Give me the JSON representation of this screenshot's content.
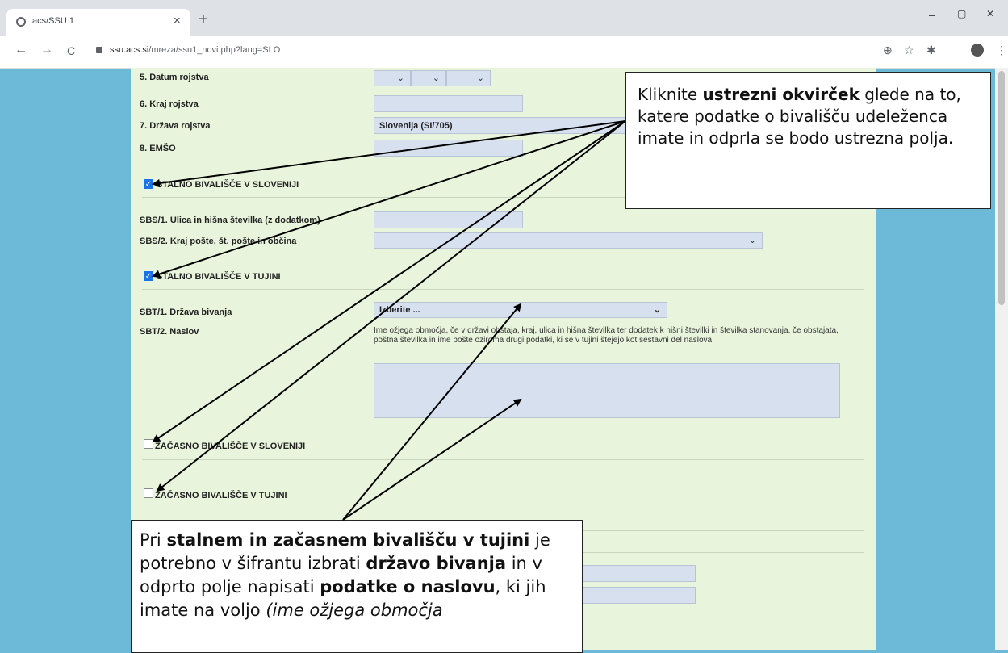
{
  "browser": {
    "tab_title": "acs/SSU 1",
    "tab_close": "×",
    "new_tab": "+",
    "url_domain": "ssu.acs.si",
    "url_path": "/mreza/ssu1_novi.php?lang=SLO",
    "min": "–",
    "max": "▢",
    "close": "✕",
    "back": "←",
    "forward": "→",
    "reload": "C",
    "zoom_icon": "⊕",
    "star_icon": "☆",
    "ext_icon": "✱",
    "menu_icon": "⋮"
  },
  "form": {
    "datum_label": "5. Datum rojstva",
    "kraj_label": "6. Kraj rojstva",
    "drzava_label": "7. Država rojstva",
    "drzava_value": "Slovenija (SI/705)",
    "emso_label": "8. EMŠO",
    "sbs_title": "STALNO BIVALIŠČE V SLOVENIJI",
    "sbs1_label": "SBS/1. Ulica in hišna številka (z dodatkom)",
    "sbs2_label": "SBS/2. Kraj pošte, št. pošte in občina",
    "sbt_title": "STALNO BIVALIŠČE V TUJINI",
    "sbt1_label": "SBT/1. Država bivanja",
    "sbt1_value": "Izberite ...",
    "sbt2_label": "SBT/2. Naslov",
    "sbt2_hint": "Ime ožjega območja, če v državi obstaja, kraj, ulica in hišna številka ter dodatek k hišni številki in številka stanovanja, če obstajata, poštna številka in ime pošte oziroma drugi podatki, ki se v tujini štejejo kot sestavni del naslova",
    "zbs_title": "ZAČASNO BIVALIŠČE V SLOVENIJI",
    "zbt_title": "ZAČASNO BIVALIŠČE V TUJINI",
    "chevron": "⌄",
    "check": "✓"
  },
  "callout1": {
    "t1": "Kliknite ",
    "b1": "ustrezni okvirček",
    "t2": " glede na to, katere podatke o bivališču udeleženca imate in odprla se bodo ustrezna polja."
  },
  "callout2": {
    "t1": "Pri ",
    "b1": "stalnem in začasnem bivališču v tujini",
    "t2": " je potrebno v šifrantu izbrati ",
    "b2": "državo bivanja",
    "t3": " in v odprto polje napisati ",
    "b3": "podatke o naslovu",
    "t4": ", ki jih imate na voljo ",
    "i1": "(ime ožjega območja"
  }
}
